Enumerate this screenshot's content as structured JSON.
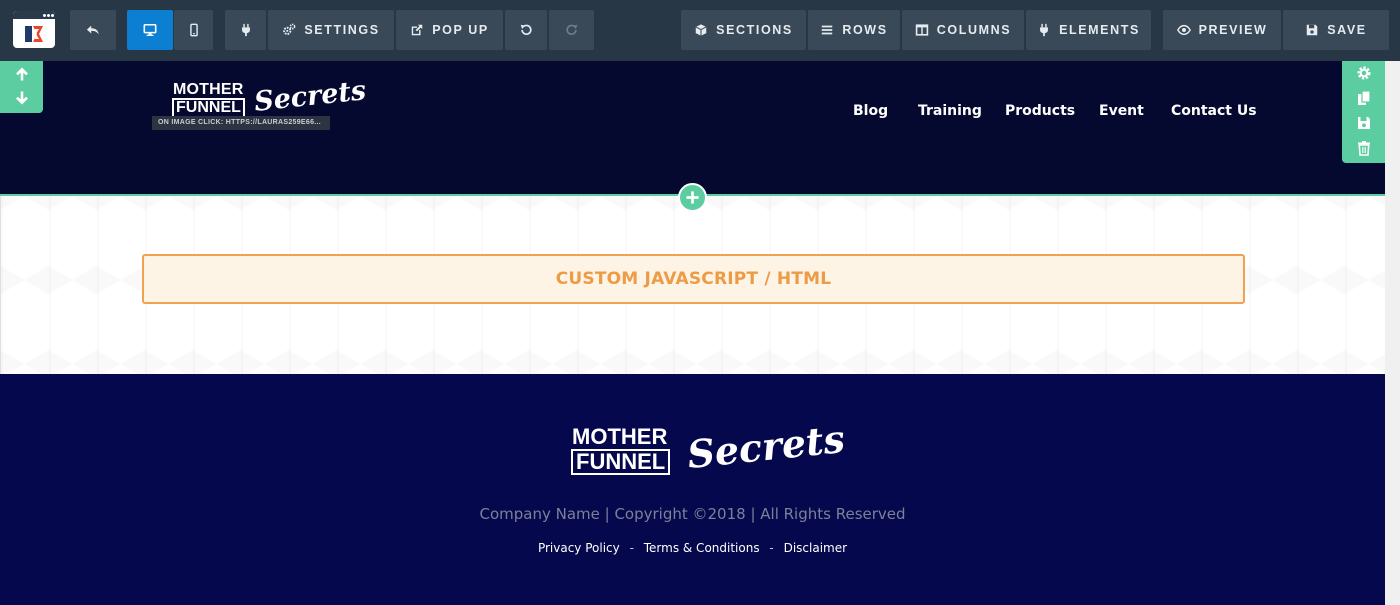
{
  "toolbar": {
    "buttons": {
      "settings": "SETTINGS",
      "popup": "POP UP",
      "sections": "SECTIONS",
      "rows": "ROWS",
      "columns": "COLUMNS",
      "elements": "ELEMENTS",
      "preview": "PREVIEW",
      "save": "SAVE"
    },
    "icons": {
      "logo": "clickfunnels-logo-icon",
      "undo_back": "reply-arrow-icon",
      "desktop": "desktop-icon",
      "mobile": "mobile-icon",
      "plugin": "plug-icon",
      "settings": "gears-icon",
      "popup": "external-edit-icon",
      "undo": "undo-icon",
      "redo": "redo-icon",
      "sections": "cube-icon",
      "rows": "bars-icon",
      "columns": "columns-icon",
      "elements": "plug-icon",
      "preview": "eye-icon",
      "save": "floppy-disk-icon"
    },
    "colors": {
      "bg": "#273746",
      "button": "#3a4958",
      "active": "#0c7fd3"
    }
  },
  "header": {
    "logo": {
      "top": "MOTHER",
      "bottom": "FUNNEL",
      "script": "Secrets"
    },
    "image_tag": "ON IMAGE CLICK: HTTPS://LAURAS259E66...",
    "nav": [
      "Blog",
      "Training",
      "Products",
      "Event",
      "Contact Us"
    ],
    "colors": {
      "bg": "#05082f",
      "accent": "#5ccda0"
    }
  },
  "middle": {
    "custom_element_label": "CUSTOM JAVASCRIPT / HTML",
    "colors": {
      "border": "#f0a250",
      "fill": "#fdf4e6",
      "text": "#ee9b45"
    }
  },
  "footer": {
    "logo": {
      "top": "MOTHER",
      "bottom": "FUNNEL",
      "script": "Secrets"
    },
    "copyright": "Company Name | Copyright ©2018 | All Rights Reserved",
    "links": [
      "Privacy Policy",
      "Terms & Conditions",
      "Disclaimer"
    ],
    "link_separator": "-",
    "colors": {
      "bg": "#05084c",
      "copyright": "#7d8099"
    }
  }
}
